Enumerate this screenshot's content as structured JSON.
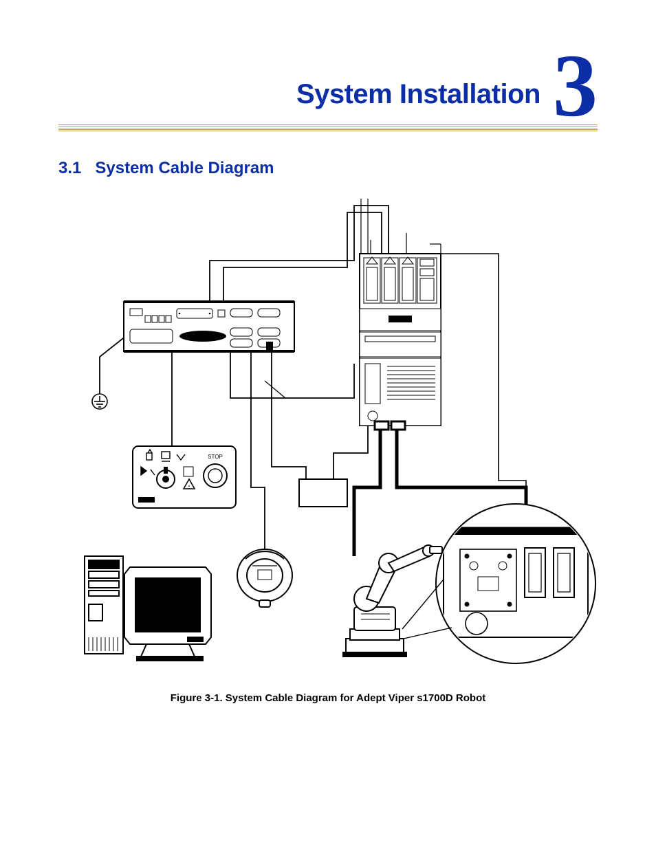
{
  "chapter": {
    "title": "System Installation",
    "number": "3"
  },
  "section": {
    "number": "3.1",
    "title": "System Cable Diagram"
  },
  "figure": {
    "caption": "Figure 3-1. System Cable Diagram for Adept Viper s1700D Robot"
  },
  "pendant": {
    "stop_label": "STOP"
  }
}
